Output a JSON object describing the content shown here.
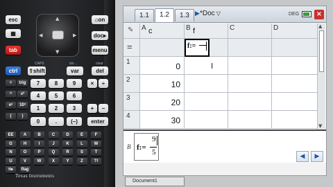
{
  "calculator": {
    "keys": {
      "esc": "esc",
      "on": "⌂on",
      "doc": "doc▸",
      "menu": "menu",
      "tab": "tab",
      "ctrl": "ctrl",
      "shift": "⇧shift",
      "var": "var",
      "del": "del",
      "digits": [
        "7",
        "8",
        "9",
        "4",
        "5",
        "6",
        "1",
        "2",
        "3",
        "0",
        ".",
        "(–)"
      ],
      "ops": [
        "×",
        "÷",
        "+",
        "–"
      ],
      "enter": "enter",
      "equals": "=",
      "trig": "trig",
      "caret": "^",
      "x2": "x²",
      "ex": "eˣ",
      "tenx": "10ˣ",
      "paren_l": "(",
      "paren_r": ")",
      "letters": [
        "EE",
        "A",
        "B",
        "C",
        "D",
        "E",
        "F",
        "G",
        "H",
        "I",
        "J",
        "K",
        "L",
        "M",
        "N",
        "O",
        "P",
        "Q",
        "R",
        "S",
        "T",
        "U",
        "V",
        "W",
        "X",
        "Y",
        "Z",
        "?!",
        "π▸",
        "flag"
      ]
    },
    "labels": {
      "caps": "CAPS",
      "clear": "clear",
      "sto": "sto→"
    },
    "brand": "Texas Instruments"
  },
  "window": {
    "tabs": [
      "1.1",
      "1.2",
      "1.3"
    ],
    "active_tab": "1.2",
    "doc_title": "*Doc",
    "mode": "DEG",
    "close": "×"
  },
  "sheet": {
    "columns": [
      {
        "letter": "A",
        "name": "c"
      },
      {
        "letter": "B",
        "name": "f"
      },
      {
        "letter": "C",
        "name": ""
      },
      {
        "letter": "D",
        "name": ""
      }
    ],
    "formula_row": {
      "b": "f:="
    },
    "rows": [
      {
        "n": "1",
        "a": "0"
      },
      {
        "n": "2",
        "a": "10"
      },
      {
        "n": "3",
        "a": "20"
      },
      {
        "n": "4",
        "a": "30"
      }
    ]
  },
  "entry_line": {
    "cell_ref": "B",
    "lhs": "f:=",
    "numerator": "9",
    "denominator": "5"
  },
  "taskbar": {
    "item": "Document1"
  }
}
